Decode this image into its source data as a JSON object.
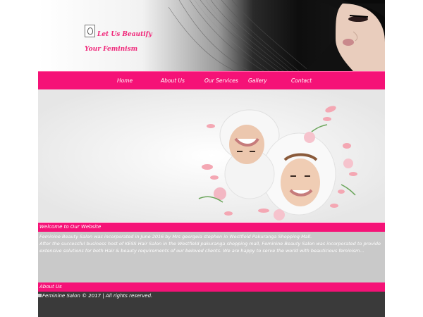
{
  "header": {
    "tagline": "Let Us Beautify Your Feminism"
  },
  "nav": {
    "items": [
      "Home",
      "About Us",
      "Our Services",
      "Gallery",
      "Contact"
    ]
  },
  "welcome": {
    "title": "Welcome to Our Website",
    "paragraph1": "Feminine Beauty Salon was incorporated in June 2016 by Mrs georgeia stephen in Westfield Pakuranga Shopping Mall.",
    "paragraph2": "After the successful business host of KESS Hair Salon in the Westfield pakuranga shopping mall, Feminine Beauty Salon was incorporated to provide extensive solutions for both Hair & beauty requirements of our beloved clients. We are happy to serve the world with beauticious feminism..."
  },
  "about": {
    "title": "About Us"
  },
  "footer": {
    "copyright": "Feminine Salon © 2017 | All rights reserved."
  },
  "colors": {
    "accent": "#f51277",
    "content_bg": "#c9c9c9",
    "footer_bg": "#3a3a3a"
  }
}
